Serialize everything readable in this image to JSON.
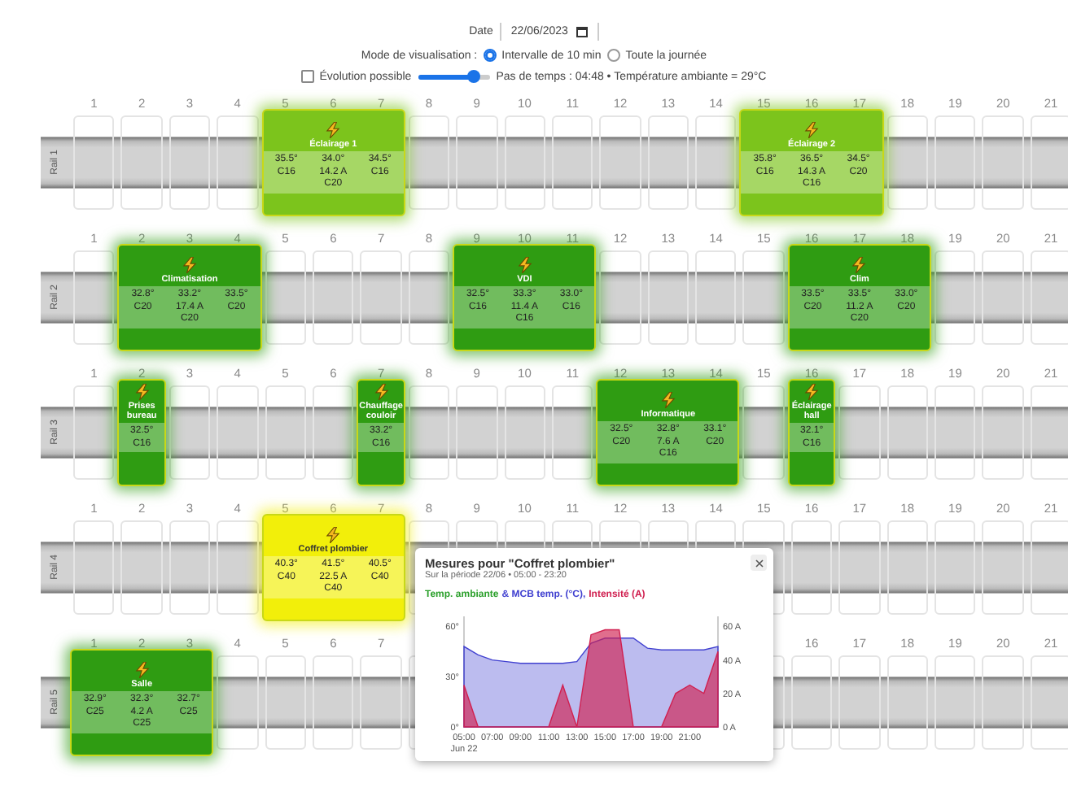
{
  "header": {
    "date_label": "Date",
    "date_value": "22/06/2023",
    "mode_label": "Mode de visualisation :",
    "modes": [
      {
        "label": "Intervalle de 10 min",
        "selected": true
      },
      {
        "label": "Toute la journée",
        "selected": false
      }
    ],
    "evolution": {
      "label": "Évolution possible",
      "checked": false
    },
    "timeline": {
      "level": 0.78
    },
    "info": "Pas de temps : 04:48 • Température ambiante = 29°C"
  },
  "rails": [
    {
      "label": "Rail 1",
      "items": [
        {
          "kind": "empty",
          "number": "1"
        },
        {
          "kind": "empty",
          "number": "2"
        },
        {
          "kind": "empty",
          "number": "3"
        },
        {
          "kind": "empty",
          "number": "4"
        },
        {
          "kind": "circuit",
          "name": "Éclairage 1",
          "color": "#7cc41c",
          "modules": [
            {
              "number": "5",
              "temp": "35.5°",
              "breaker": "C16"
            },
            {
              "number": "6",
              "temp": "34.0°",
              "current": "14.2 A",
              "breaker": "C20"
            },
            {
              "number": "7",
              "temp": "34.5°",
              "breaker": "C16"
            }
          ]
        },
        {
          "kind": "empty",
          "number": "8"
        },
        {
          "kind": "empty",
          "number": "9"
        },
        {
          "kind": "empty",
          "number": "10"
        },
        {
          "kind": "empty",
          "number": "11"
        },
        {
          "kind": "empty",
          "number": "12"
        },
        {
          "kind": "empty",
          "number": "13"
        },
        {
          "kind": "empty",
          "number": "14"
        },
        {
          "kind": "circuit",
          "name": "Éclairage 2",
          "color": "#7cc41c",
          "modules": [
            {
              "number": "15",
              "temp": "35.8°",
              "breaker": "C16"
            },
            {
              "number": "16",
              "temp": "36.5°",
              "current": "14.3 A",
              "breaker": "C16"
            },
            {
              "number": "17",
              "temp": "34.5°",
              "breaker": "C20"
            }
          ]
        },
        {
          "kind": "empty",
          "number": "18"
        },
        {
          "kind": "empty",
          "number": "19"
        },
        {
          "kind": "empty",
          "number": "20"
        },
        {
          "kind": "empty",
          "number": "21"
        }
      ]
    },
    {
      "label": "Rail 2",
      "items": [
        {
          "kind": "empty",
          "number": "1"
        },
        {
          "kind": "circuit",
          "name": "Climatisation",
          "color": "#2f9c12",
          "modules": [
            {
              "number": "2",
              "temp": "32.8°",
              "breaker": "C20"
            },
            {
              "number": "3",
              "temp": "33.2°",
              "current": "17.4 A",
              "breaker": "C20"
            },
            {
              "number": "4",
              "temp": "33.5°",
              "breaker": "C20"
            }
          ]
        },
        {
          "kind": "empty",
          "number": "5"
        },
        {
          "kind": "empty",
          "number": "6"
        },
        {
          "kind": "empty",
          "number": "7"
        },
        {
          "kind": "empty",
          "number": "8"
        },
        {
          "kind": "circuit",
          "name": "VDI",
          "color": "#2f9c12",
          "modules": [
            {
              "number": "9",
              "temp": "32.5°",
              "breaker": "C16"
            },
            {
              "number": "10",
              "temp": "33.3°",
              "current": "11.4 A",
              "breaker": "C16"
            },
            {
              "number": "11",
              "temp": "33.0°",
              "breaker": "C16"
            }
          ]
        },
        {
          "kind": "empty",
          "number": "12"
        },
        {
          "kind": "empty",
          "number": "13"
        },
        {
          "kind": "empty",
          "number": "14"
        },
        {
          "kind": "empty",
          "number": "15"
        },
        {
          "kind": "circuit",
          "name": "Clim",
          "color": "#2f9c12",
          "modules": [
            {
              "number": "16",
              "temp": "33.5°",
              "breaker": "C20"
            },
            {
              "number": "17",
              "temp": "33.5°",
              "current": "11.2 A",
              "breaker": "C20"
            },
            {
              "number": "18",
              "temp": "33.0°",
              "breaker": "C20"
            }
          ]
        },
        {
          "kind": "empty",
          "number": "19"
        },
        {
          "kind": "empty",
          "number": "20"
        },
        {
          "kind": "empty",
          "number": "21"
        }
      ]
    },
    {
      "label": "Rail 3",
      "items": [
        {
          "kind": "empty",
          "number": "1"
        },
        {
          "kind": "circuit",
          "name": "Prises bureau",
          "color": "#2f9c12",
          "modules": [
            {
              "number": "2",
              "temp": "32.5°",
              "breaker": "C16"
            }
          ]
        },
        {
          "kind": "empty",
          "number": "3"
        },
        {
          "kind": "empty",
          "number": "4"
        },
        {
          "kind": "empty",
          "number": "5"
        },
        {
          "kind": "empty",
          "number": "6"
        },
        {
          "kind": "circuit",
          "name": "Chauffage couloir",
          "color": "#2f9c12",
          "modules": [
            {
              "number": "7",
              "temp": "33.2°",
              "breaker": "C16"
            }
          ]
        },
        {
          "kind": "empty",
          "number": "8"
        },
        {
          "kind": "empty",
          "number": "9"
        },
        {
          "kind": "empty",
          "number": "10"
        },
        {
          "kind": "empty",
          "number": "11"
        },
        {
          "kind": "circuit",
          "name": "Informatique",
          "color": "#2f9c12",
          "modules": [
            {
              "number": "12",
              "temp": "32.5°",
              "breaker": "C20"
            },
            {
              "number": "13",
              "temp": "32.8°",
              "current": "7.6 A",
              "breaker": "C16"
            },
            {
              "number": "14",
              "temp": "33.1°",
              "breaker": "C20"
            }
          ]
        },
        {
          "kind": "empty",
          "number": "15"
        },
        {
          "kind": "circuit",
          "name": "Éclairage hall",
          "color": "#2f9c12",
          "modules": [
            {
              "number": "16",
              "temp": "32.1°",
              "breaker": "C16"
            }
          ]
        },
        {
          "kind": "empty",
          "number": "17"
        },
        {
          "kind": "empty",
          "number": "18"
        },
        {
          "kind": "empty",
          "number": "19"
        },
        {
          "kind": "empty",
          "number": "20"
        },
        {
          "kind": "empty",
          "number": "21"
        }
      ]
    },
    {
      "label": "Rail 4",
      "items": [
        {
          "kind": "empty",
          "number": "1"
        },
        {
          "kind": "empty",
          "number": "2"
        },
        {
          "kind": "empty",
          "number": "3"
        },
        {
          "kind": "empty",
          "number": "4"
        },
        {
          "kind": "circuit",
          "name": "Coffret plombier",
          "color": "#f2ef0a",
          "modules": [
            {
              "number": "5",
              "temp": "40.3°",
              "breaker": "C40"
            },
            {
              "number": "6",
              "temp": "41.5°",
              "current": "22.5 A",
              "breaker": "C40"
            },
            {
              "number": "7",
              "temp": "40.5°",
              "breaker": "C40"
            }
          ]
        },
        {
          "kind": "empty",
          "number": "8"
        },
        {
          "kind": "empty",
          "number": "9"
        },
        {
          "kind": "empty",
          "number": "10"
        },
        {
          "kind": "empty",
          "number": "11"
        },
        {
          "kind": "empty",
          "number": "12"
        },
        {
          "kind": "empty",
          "number": "13"
        },
        {
          "kind": "empty",
          "number": "14"
        },
        {
          "kind": "empty",
          "number": "15"
        },
        {
          "kind": "empty",
          "number": "16"
        },
        {
          "kind": "empty",
          "number": "17"
        },
        {
          "kind": "empty",
          "number": "18"
        },
        {
          "kind": "empty",
          "number": "19"
        },
        {
          "kind": "empty",
          "number": "20"
        },
        {
          "kind": "empty",
          "number": "21"
        }
      ]
    },
    {
      "label": "Rail 5",
      "items": [
        {
          "kind": "circuit",
          "name": "Salle",
          "color": "#2f9c12",
          "modules": [
            {
              "number": "1",
              "temp": "32.9°",
              "breaker": "C25"
            },
            {
              "number": "2",
              "temp": "32.3°",
              "current": "4.2 A",
              "breaker": "C25"
            },
            {
              "number": "3",
              "temp": "32.7°",
              "breaker": "C25"
            }
          ]
        },
        {
          "kind": "empty",
          "number": "4"
        },
        {
          "kind": "empty",
          "number": "5"
        },
        {
          "kind": "empty",
          "number": "6"
        },
        {
          "kind": "empty",
          "number": "7"
        },
        {
          "kind": "empty"
        },
        {
          "kind": "empty"
        },
        {
          "kind": "empty"
        },
        {
          "kind": "empty"
        },
        {
          "kind": "empty"
        },
        {
          "kind": "empty"
        },
        {
          "kind": "empty"
        },
        {
          "kind": "empty"
        },
        {
          "kind": "empty",
          "number": "16"
        },
        {
          "kind": "empty",
          "number": "17"
        },
        {
          "kind": "empty",
          "number": "18"
        },
        {
          "kind": "empty",
          "number": "19"
        },
        {
          "kind": "empty",
          "number": "20"
        },
        {
          "kind": "empty",
          "number": "21"
        }
      ]
    }
  ],
  "popup": {
    "title": "Mesures pour \"Coffret plombier\"",
    "subtitle": "Sur la période 22/06 • 05:00 - 23:20",
    "legend": [
      {
        "label": "Temp. ambiante",
        "color": "#2ca02c"
      }
    ],
    "chart_data": {
      "type": "area",
      "x": [
        5,
        6,
        7,
        8,
        9,
        10,
        11,
        12,
        13,
        14,
        15,
        16,
        17,
        18,
        19,
        20,
        21,
        22,
        23
      ],
      "series": [
        {
          "name": "& MCB temp. (°C),",
          "color": "#4040d0",
          "values": [
            48,
            43,
            40,
            39,
            38,
            38,
            38,
            38,
            39,
            50,
            53,
            53,
            53,
            47,
            46,
            46,
            46,
            46,
            48
          ]
        },
        {
          "name": "Intensité (A)",
          "color": "#d02050",
          "values": [
            25,
            0,
            0,
            0,
            0,
            0,
            0,
            25,
            0,
            55,
            58,
            58,
            0,
            0,
            0,
            20,
            25,
            20,
            45
          ]
        }
      ],
      "xlim": [
        5,
        23
      ],
      "xticks": [
        {
          "value": 5,
          "label": "05:00"
        },
        {
          "value": 7,
          "label": "07:00"
        },
        {
          "value": 9,
          "label": "09:00"
        },
        {
          "value": 11,
          "label": "11:00"
        },
        {
          "value": 13,
          "label": "13:00"
        },
        {
          "value": 15,
          "label": "15:00"
        },
        {
          "value": 17,
          "label": "17:00"
        },
        {
          "value": 19,
          "label": "19:00"
        },
        {
          "value": 21,
          "label": "21:00"
        }
      ],
      "ylim": [
        0,
        66
      ],
      "yticks": [
        {
          "value": 0,
          "label": "0°"
        },
        {
          "value": 30,
          "label": "30°"
        },
        {
          "value": 60,
          "label": "60°"
        }
      ],
      "y2lim": [
        0,
        66
      ],
      "y2ticks": [
        {
          "value": 0,
          "label": "0 A"
        },
        {
          "value": 20,
          "label": "20 A"
        },
        {
          "value": 40,
          "label": "40 A"
        },
        {
          "value": 60,
          "label": "60 A"
        }
      ],
      "annotations": [
        "Jun 22"
      ]
    }
  }
}
